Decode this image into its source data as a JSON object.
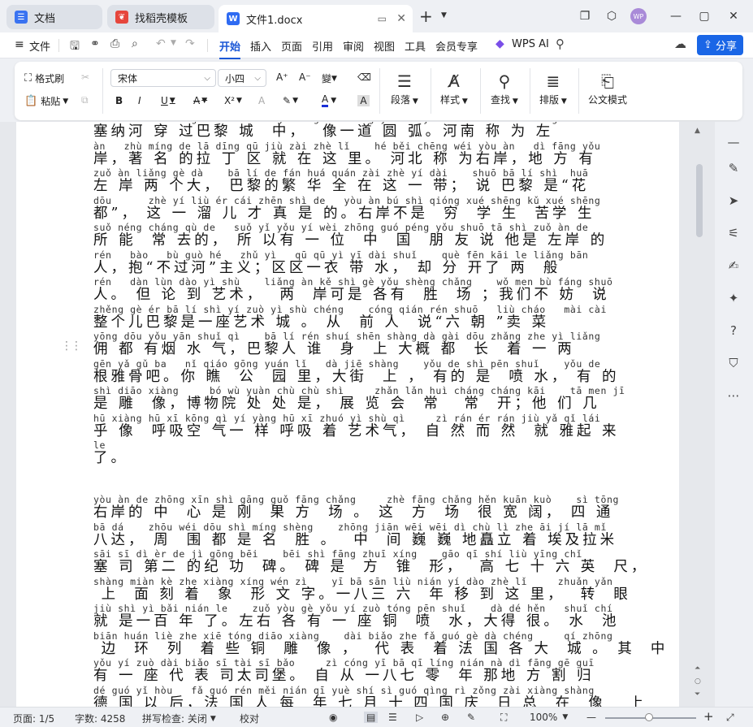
{
  "tabs": [
    {
      "label": "文档",
      "icon": "docs-home-icon",
      "color": "#3a73f1"
    },
    {
      "label": "找稻壳模板",
      "icon": "docer-icon",
      "color": "#e6463c"
    },
    {
      "label": "文件1.docx",
      "icon": "word-doc-icon",
      "color": "#2f6bf2"
    }
  ],
  "user_avatar": "WP",
  "menu": {
    "file": "文件",
    "items": [
      "开始",
      "插入",
      "页面",
      "引用",
      "审阅",
      "视图",
      "工具",
      "会员专享"
    ],
    "active": "开始",
    "wps_ai": "WPS AI",
    "share": "分享"
  },
  "ribbon": {
    "format_painter": "格式刷",
    "paste": "粘贴",
    "font_name": "宋体",
    "font_size": "小四",
    "paragraph": "段落",
    "style": "样式",
    "find": "查找",
    "layout": "排版",
    "official": "公文模式"
  },
  "document": {
    "lines": [
      {
        "py": "sai na he chuan guo ba li cheng zhong    xiang yi dao yuan hu   he nan cheng wei zuo",
        "hz": "塞纳河 穿 过巴黎 城  中，  像一道 圆 弧。河南 称 为 左"
      },
      {
        "py": "àn   zhù míng de lā dīng qū jiù zài zhè lǐ    hé běi chēng wéi yòu àn   dì fāng yǒu",
        "hz": "岸，著 名 的拉 丁 区 就 在 这 里。 河北 称 为右岸，地 方 有"
      },
      {
        "py": "zuǒ àn liǎng gè dà    bā lí de fán huá quán zài zhè yí dài    shuō bā lí shì  huā",
        "hz": "左 岸 两 个大， 巴黎的繁 华 全 在 这 一 带； 说 巴黎 是“花"
      },
      {
        "py": "dōu      zhè yí liù ér cái zhēn shì de   yòu àn bú shì qióng xué shēng kǔ xué shēng",
        "hz": "都”， 这 一 溜 儿 才 真 是 的。右岸不是  穷  学 生  苦学 生"
      },
      {
        "py": "suǒ néng cháng qù de   suǒ yǐ yǒu yí wèi zhōng guó péng yǒu shuō tā shì zuǒ àn de",
        "hz": "所 能  常 去的， 所 以有 一 位  中  国  朋 友 说 他是 左岸 的"
      },
      {
        "py": "rén   bào   bù guò hé   zhǔ yì   qū qū yì yī dài shuǐ    què fēn kāi le liǎng bān",
        "hz": "人，抱“不过河”主义；区区一衣 带 水， 却 分 开了 两  般"
      },
      {
        "py": "rén   dàn lùn dào yì shù    liǎng àn kě shì gè yǒu shèng chǎng    wǒ men bù fáng shuō",
        "hz": "人。 但 论 到 艺术，  两  岸可是 各有  胜  场 ；我们不 妨  说"
      },
      {
        "py": "zhěng gè ér bā lí shì yí zuò yì shù chéng    cóng qián rén shuō   liù cháo   mài cài",
        "hz": "整个儿巴黎是一座艺术 城 。 从  前 人  说“六 朝 ”卖 菜"
      },
      {
        "py": "yōng dōu yǒu yān shuǐ qì    bā lí rén shuí shēn shàng dà gài dōu zhǎng zhe yì liǎng",
        "hz": "佣 都 有烟 水 气，巴黎人 谁  身  上 大概 都  长  着 一 两"
      },
      {
        "py": "gēn yǎ gǔ ba   nǐ qiáo gōng yuán lǐ   dà jiē shàng    yǒu de shì pēn shuǐ    yǒu de",
        "hz": "根雅骨吧。你 瞧  公  园 里，大街  上 ， 有的 是  喷 水， 有 的"
      },
      {
        "py": "shì diāo xiàng     bó wù yuàn chù chù shì     zhǎn lǎn huì cháng cháng kāi    tā men jī",
        "hz": "是 雕  像，博物院 处 处 是， 展 览 会  常   常  开；他 们 几"
      },
      {
        "py": "hū xiàng hū xī kōng qì yí yàng hū xī zhuó yì shù qì     zì rán ér rán jiù yǎ qǐ lái",
        "hz": "乎 像  呼吸空 气一 样 呼吸 着 艺术气， 自 然 而 然  就 雅起 来"
      },
      {
        "py": "le",
        "hz": "了。"
      },
      {
        "py": "",
        "hz": ""
      },
      {
        "py": "yòu àn de zhōng xīn shì gāng guǒ fāng chǎng     zhè fāng chǎng hěn kuān kuò    sì tōng",
        "hz": "右岸的 中  心 是 刚  果 方  场 。 这  方  场  很 宽 阔， 四 通"
      },
      {
        "py": "bā dá    zhōu wéi dōu shì míng shèng    zhōng jiān wēi wēi dì chù lì zhe āi jí lā mǐ",
        "hz": "八达， 周  围 都 是 名  胜 。  中  间 巍 巍 地矗立 着 埃及拉米"
      },
      {
        "py": "sāi sī dì èr de jì gōng bēi    bēi shì fāng zhuī xíng    gāo qī shí liù yīng chǐ",
        "hz": "塞 司 第二 的纪 功  碑。 碑 是  方  锥  形，  高 七 十 六 英  尺，"
      },
      {
        "py": "shàng miàn kè zhe xiàng xíng wén zì    yī bā sān liù nián yí dào zhè lǐ     zhuǎn yǎn",
        "hz": " 上  面 刻 着  象  形 文 字。一八三 六  年 移 到 这 里，  转  眼"
      },
      {
        "py": "jiù shì yì bǎi nián le    zuǒ yòu gè yǒu yí zuò tóng pēn shuǐ    dà dé hěn   shuǐ chí",
        "hz": "就 是一百 年 了。左右 各 有 一 座 铜  喷  水，大得 很。 水  池"
      },
      {
        "py": "biān huán liè zhe xiē tóng diāo xiàng    dài biǎo zhe fǎ guó gè dà chéng     qí zhōng",
        "hz": " 边  环  列  着 些 铜  雕  像 ，  代 表  着 法 国 各 大  城 。 其  中"
      },
      {
        "py": "yǒu yí zuò dài biǎo sī tài sī bǎo     zì cóng yī bā qī líng nián nà dì fāng gē guī",
        "hz": "有 一 座 代 表 司太司堡。 自 从 一八七 零  年 那地 方 割 归"
      },
      {
        "py": "dé guó yǐ hòu   fǎ guó rén měi nián qī yuè shí sì guó qìng rì zǒng zài xiàng shàng",
        "hz": "德 国 以 后，法 国 人 每  年 七 月 十 四 国 庆  日 总  在  像   上"
      },
      {
        "py": "",
        "hz": ""
      }
    ]
  },
  "status": {
    "page": "页面: 1/5",
    "words": "字数: 4258",
    "spell": "拼写检查: 关闭",
    "proof": "校对",
    "zoom": "100%",
    "zoom_fraction": 0.48
  }
}
